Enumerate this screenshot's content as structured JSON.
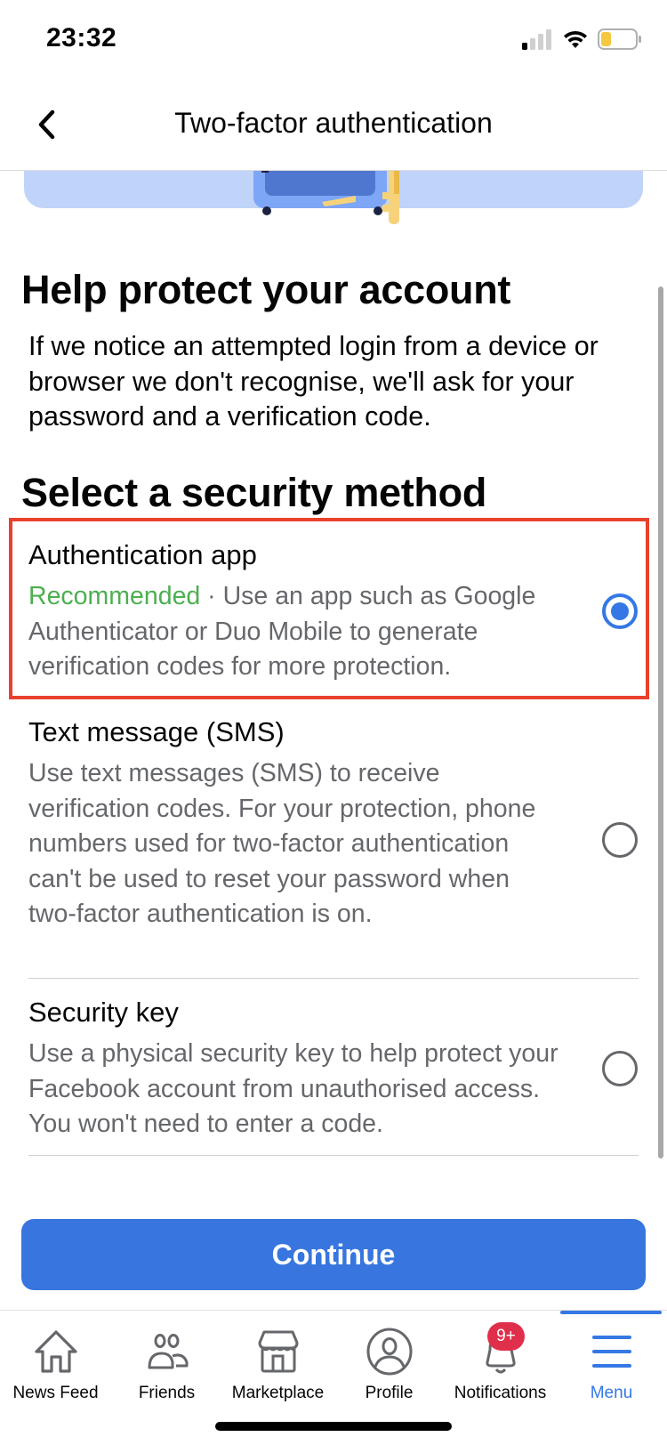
{
  "status_bar": {
    "time": "23:32",
    "signal_bars_filled": 1,
    "signal_bars_total": 4,
    "battery_level": 0.25,
    "battery_color": "#f5c842"
  },
  "header": {
    "back_icon": "chevron-left-icon",
    "title": "Two-factor authentication"
  },
  "illustration": {
    "icon": "safe-with-key-illustration"
  },
  "main": {
    "heading": "Help protect your account",
    "intro": "If we notice an attempted login from a device or browser we don't recognise, we'll ask for your password and a verification code.",
    "section_heading": "Select a security method",
    "options": [
      {
        "title": "Authentication app",
        "badge": "Recommended",
        "separator": " · ",
        "description": "Use an app such as Google Authenticator or Duo Mobile to generate verification codes for more protection.",
        "selected": true
      },
      {
        "title": "Text message (SMS)",
        "description": "Use text messages (SMS) to receive verification codes. For your protection, phone numbers used for two-factor authentication can't be used to reset your password when two-factor authentication is on.",
        "selected": false
      },
      {
        "title": "Security key",
        "description": "Use a physical security key to help protect your Facebook account from unauthorised access. You won't need to enter a code.",
        "selected": false
      }
    ],
    "continue_label": "Continue"
  },
  "tab_bar": {
    "tabs": [
      {
        "label": "News Feed",
        "icon": "home-icon"
      },
      {
        "label": "Friends",
        "icon": "friends-icon"
      },
      {
        "label": "Marketplace",
        "icon": "marketplace-icon"
      },
      {
        "label": "Profile",
        "icon": "profile-icon"
      },
      {
        "label": "Notifications",
        "icon": "bell-icon",
        "badge": "9+"
      },
      {
        "label": "Menu",
        "icon": "menu-icon",
        "active": true
      }
    ]
  },
  "colors": {
    "accent": "#3578e5",
    "button": "#3875de",
    "recommended": "#4caf50",
    "highlight": "#e8412c",
    "badge": "#e02f4b"
  }
}
